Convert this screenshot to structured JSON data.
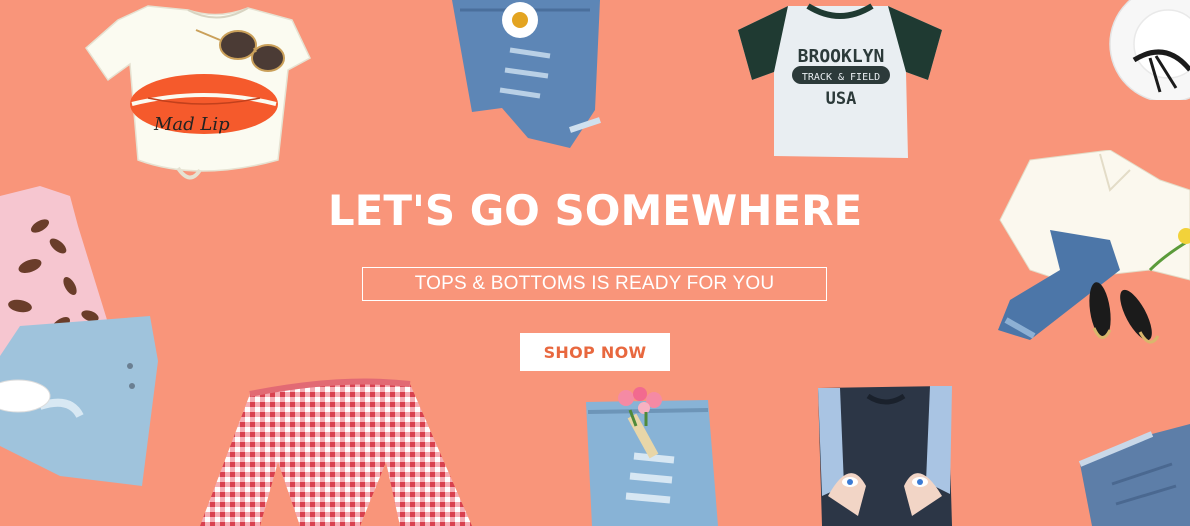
{
  "banner": {
    "headline": "LET'S GO SOMEWHERE",
    "subheadline": "TOPS & BOTTOMS IS READY FOR YOU",
    "cta_label": "SHOP NOW"
  },
  "products": {
    "brooklyn_tee": {
      "line1": "BROOKLYN",
      "line2": "TRACK & FIELD",
      "line3": "USA"
    },
    "lips_tee_script": "Mad Lip"
  },
  "colors": {
    "background": "#f9957a",
    "cta_text": "#e8683f",
    "text": "#ffffff"
  }
}
